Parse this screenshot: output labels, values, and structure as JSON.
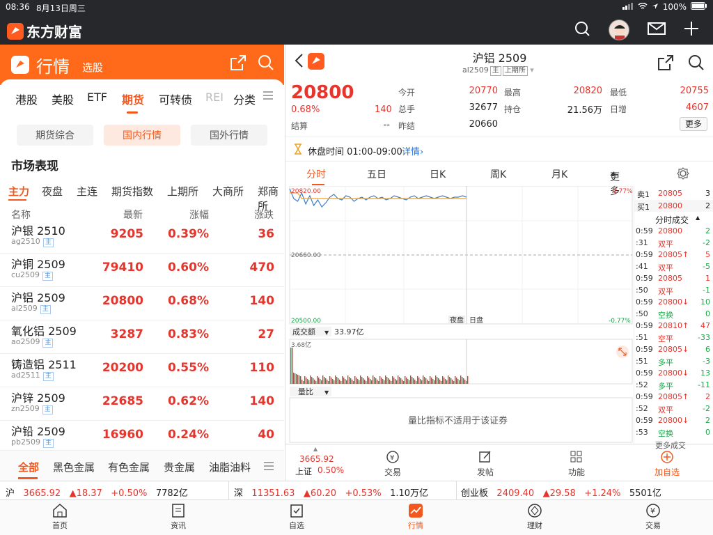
{
  "status": {
    "time": "08:36",
    "date": "8月13日周三",
    "battery": "100%"
  },
  "app": {
    "name": "东方财富"
  },
  "left": {
    "title": "行情",
    "subtitle": "选股",
    "categories": [
      "港股",
      "美股",
      "ETF",
      "期货",
      "可转债",
      "REI",
      "分类"
    ],
    "segments": [
      "期货综合",
      "国内行情",
      "国外行情"
    ],
    "section_title": "市场表现",
    "subtabs": [
      "主力",
      "夜盘",
      "主连",
      "期货指数",
      "上期所",
      "大商所",
      "郑商所"
    ],
    "columns": {
      "name": "名称",
      "last": "最新",
      "chg_pct": "涨幅",
      "chg": "涨跌"
    },
    "rows": [
      {
        "name": "沪银 2510",
        "code": "ag2510",
        "tag": "主",
        "last": "9205",
        "pct": "0.39%",
        "chg": "36"
      },
      {
        "name": "沪铜 2509",
        "code": "cu2509",
        "tag": "主",
        "last": "79410",
        "pct": "0.60%",
        "chg": "470"
      },
      {
        "name": "沪铝 2509",
        "code": "al2509",
        "tag": "主",
        "last": "20800",
        "pct": "0.68%",
        "chg": "140"
      },
      {
        "name": "氧化铝 2509",
        "code": "ao2509",
        "tag": "主",
        "last": "3287",
        "pct": "0.83%",
        "chg": "27"
      },
      {
        "name": "铸造铝 2511",
        "code": "ad2511",
        "tag": "主",
        "last": "20200",
        "pct": "0.55%",
        "chg": "110"
      },
      {
        "name": "沪锌 2509",
        "code": "zn2509",
        "tag": "主",
        "last": "22685",
        "pct": "0.62%",
        "chg": "140"
      },
      {
        "name": "沪铅 2509",
        "code": "pb2509",
        "tag": "主",
        "last": "16960",
        "pct": "0.24%",
        "chg": "40"
      }
    ],
    "bottom_categories": [
      "全部",
      "黑色金属",
      "有色金属",
      "贵金属",
      "油脂油料"
    ]
  },
  "right": {
    "title": "沪铝 2509",
    "code": "al2509",
    "tag1": "主",
    "tag2": "上期所",
    "price": "20800",
    "pct": "0.68%",
    "chg": "140",
    "stats": {
      "open_label": "今开",
      "open": "20770",
      "high_label": "最高",
      "high": "20820",
      "low_label": "最低",
      "low": "20755",
      "volume_label": "总手",
      "volume": "32677",
      "oi_label": "持仓",
      "oi": "21.56万",
      "inc_label": "日增",
      "inc": "4607",
      "settle_label": "结算",
      "settle": "--",
      "prev_label": "昨结",
      "prev": "20660"
    },
    "more": "更多",
    "rest_label": "休盘时间 01:00-09:00",
    "rest_detail": "详情",
    "chart_tabs": [
      "分时",
      "五日",
      "日K",
      "周K",
      "月K",
      "更多"
    ],
    "axis": {
      "top": "20820.00",
      "mid": "20660.00",
      "bottom": "20500.00",
      "top_pct": "0.77%",
      "bottom_pct": "-0.77%",
      "night": "夜盘",
      "day": "日盘"
    },
    "turnover_label": "成交额",
    "turnover": "33.97亿",
    "vol_max": "3.68亿",
    "ratio_label": "量比",
    "ratio_msg": "量比指标不适用于该证券",
    "orderbook": {
      "ask_label": "卖1",
      "ask_price": "20805",
      "ask_qty": "3",
      "bid_label": "买1",
      "bid_price": "20800",
      "bid_qty": "2"
    },
    "trades_title": "分时成交",
    "trades": [
      {
        "t": "0:59",
        "p": "20800",
        "q": "2",
        "pc": "red",
        "qc": "green"
      },
      {
        "t": ":31",
        "p": "双平",
        "q": "-2",
        "pc": "red",
        "qc": "green"
      },
      {
        "t": "0:59",
        "p": "20805↑",
        "q": "5",
        "pc": "red",
        "qc": "red"
      },
      {
        "t": ":41",
        "p": "双平",
        "q": "-5",
        "pc": "red",
        "qc": "green"
      },
      {
        "t": "0:59",
        "p": "20805",
        "q": "1",
        "pc": "red",
        "qc": "red"
      },
      {
        "t": ":50",
        "p": "双平",
        "q": "-1",
        "pc": "red",
        "qc": "green"
      },
      {
        "t": "0:59",
        "p": "20800↓",
        "q": "10",
        "pc": "red",
        "qc": "green"
      },
      {
        "t": ":50",
        "p": "空换",
        "q": "0",
        "pc": "green",
        "qc": "green"
      },
      {
        "t": "0:59",
        "p": "20810↑",
        "q": "47",
        "pc": "red",
        "qc": "red"
      },
      {
        "t": ":51",
        "p": "空平",
        "q": "-33",
        "pc": "red",
        "qc": "green"
      },
      {
        "t": "0:59",
        "p": "20805↓",
        "q": "6",
        "pc": "red",
        "qc": "green"
      },
      {
        "t": ":51",
        "p": "多平",
        "q": "-3",
        "pc": "green",
        "qc": "green"
      },
      {
        "t": "0:59",
        "p": "20800↓",
        "q": "13",
        "pc": "red",
        "qc": "green"
      },
      {
        "t": ":52",
        "p": "多平",
        "q": "-11",
        "pc": "green",
        "qc": "green"
      },
      {
        "t": "0:59",
        "p": "20805↑",
        "q": "2",
        "pc": "red",
        "qc": "red"
      },
      {
        "t": ":52",
        "p": "双平",
        "q": "-2",
        "pc": "red",
        "qc": "green"
      },
      {
        "t": "0:59",
        "p": "20800↓",
        "q": "2",
        "pc": "red",
        "qc": "green"
      },
      {
        "t": ":53",
        "p": "空换",
        "q": "0",
        "pc": "green",
        "qc": "green"
      }
    ],
    "more_trades": "更多成交",
    "bottom": {
      "index_value": "3665.92",
      "index_name": "上证",
      "index_pct": "0.50%",
      "trade": "交易",
      "post": "发帖",
      "func": "功能",
      "add": "加自选"
    }
  },
  "ticker": [
    {
      "name": "沪",
      "value": "3665.92",
      "chg": "▲18.37",
      "pct": "+0.50%",
      "amt": "7782亿"
    },
    {
      "name": "深",
      "value": "11351.63",
      "chg": "▲60.20",
      "pct": "+0.53%",
      "amt": "1.10万亿"
    },
    {
      "name": "创业板",
      "value": "2409.40",
      "chg": "▲29.58",
      "pct": "+1.24%",
      "amt": "5501亿"
    }
  ],
  "tabbar": [
    "首页",
    "资讯",
    "自选",
    "行情",
    "理财",
    "交易"
  ],
  "colors": {
    "accent": "#f2581e",
    "up": "#e5352d",
    "down": "#1ba548",
    "dark": "#27282b"
  }
}
